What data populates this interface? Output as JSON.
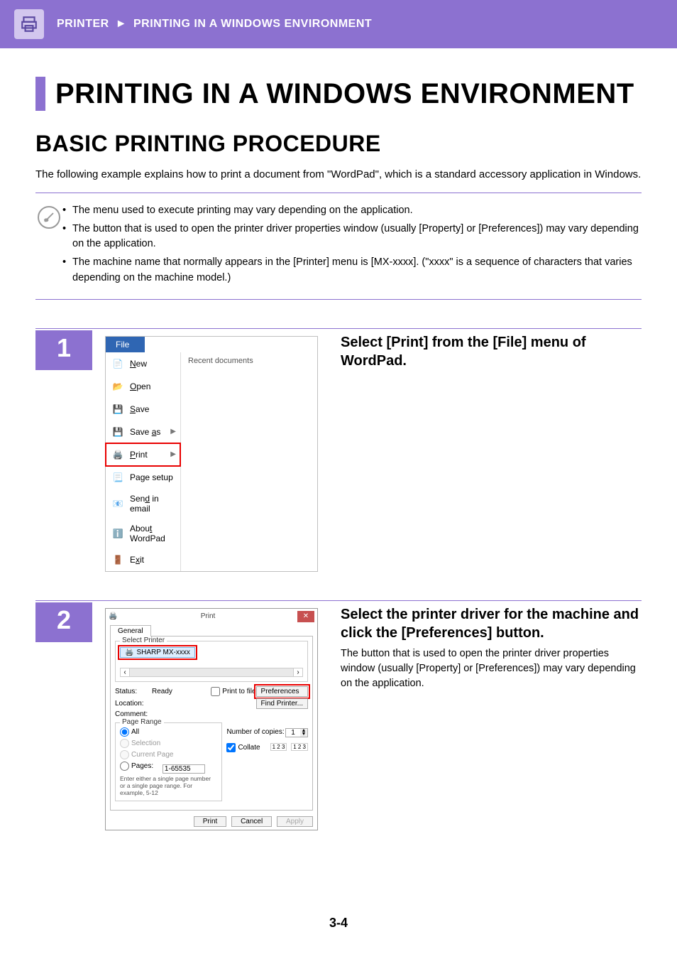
{
  "header": {
    "breadcrumb_section": "PRINTER",
    "breadcrumb_page": "PRINTING IN A WINDOWS ENVIRONMENT"
  },
  "h1": "PRINTING IN A WINDOWS ENVIRONMENT",
  "h2": "BASIC PRINTING PROCEDURE",
  "intro": "The following example explains how to print a document from \"WordPad\", which is a standard accessory application in Windows.",
  "notes": {
    "b1": "The menu used to execute printing may vary depending on the application.",
    "b2": "The button that is used to open the printer driver properties window (usually [Property] or [Preferences]) may vary depending on the application.",
    "b3": "The machine name that normally appears in the [Printer] menu is [MX-xxxx]. (\"xxxx\" is a sequence of characters that varies depending on the machine model.)"
  },
  "step1": {
    "num": "1",
    "title": "Select [Print] from the [File] menu of WordPad.",
    "menu": {
      "file": "File",
      "recent": "Recent documents",
      "new": "New",
      "open": "Open",
      "save": "Save",
      "save_as": "Save as",
      "print": "Print",
      "page_setup": "Page setup",
      "send_email": "Send in email",
      "about": "About WordPad",
      "exit": "Exit"
    }
  },
  "step2": {
    "num": "2",
    "title": "Select the printer driver for the machine and click the [Preferences] button.",
    "body": "The button that is used to open the printer driver properties window (usually [Property] or [Preferences]) may vary depending on the application.",
    "dlg": {
      "title": "Print",
      "tab_general": "General",
      "fs_select_printer": "Select Printer",
      "printer_name": "SHARP MX-xxxx",
      "status_lbl": "Status:",
      "status_val": "Ready",
      "location_lbl": "Location:",
      "comment_lbl": "Comment:",
      "print_to_file": "Print to file",
      "preferences_btn": "Preferences",
      "find_printer_btn": "Find Printer...",
      "fs_page_range": "Page Range",
      "all": "All",
      "selection": "Selection",
      "current_page": "Current Page",
      "pages": "Pages:",
      "pages_val": "1-65535",
      "pages_hint": "Enter either a single page number or a single page range.  For example, 5-12",
      "num_copies_lbl": "Number of copies:",
      "num_copies_val": "1",
      "collate": "Collate",
      "btn_print": "Print",
      "btn_cancel": "Cancel",
      "btn_apply": "Apply"
    }
  },
  "page_number": "3-4"
}
